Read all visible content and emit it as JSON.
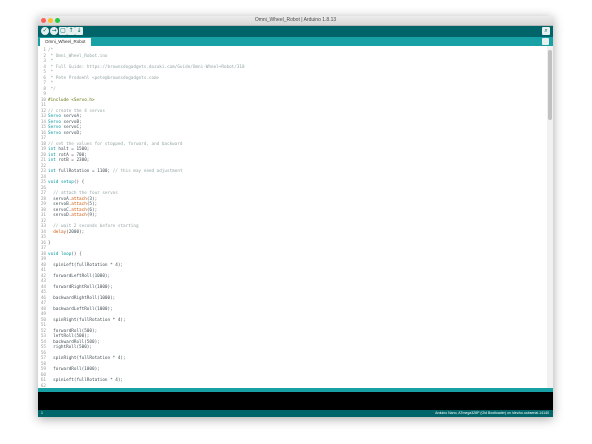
{
  "window": {
    "title": "Omni_Wheel_Robot | Arduino 1.8.13"
  },
  "toolbar": {
    "buttons": [
      {
        "name": "verify-button",
        "glyph": "✓"
      },
      {
        "name": "upload-button",
        "glyph": "→"
      },
      {
        "name": "new-button",
        "glyph": "▢"
      },
      {
        "name": "open-button",
        "glyph": "↑"
      },
      {
        "name": "save-button",
        "glyph": "↓"
      }
    ],
    "serial_glyph": "⌕"
  },
  "tabs": [
    {
      "label": "Omni_Wheel_Robot"
    }
  ],
  "editor": {
    "lines": [
      {
        "n": "1",
        "seg": [
          [
            "cm",
            "/*"
          ]
        ]
      },
      {
        "n": "2",
        "seg": [
          [
            "cm",
            " * Omni_Wheel_Robot.ino"
          ]
        ]
      },
      {
        "n": "3",
        "seg": [
          [
            "cm",
            " *"
          ]
        ]
      },
      {
        "n": "4",
        "seg": [
          [
            "cm",
            " * Full Guide: https://brownsdogadgets.dozuki.com/Guide/Omni-Wheel+Robot/318"
          ]
        ]
      },
      {
        "n": "5",
        "seg": [
          [
            "cm",
            " *"
          ]
        ]
      },
      {
        "n": "6",
        "seg": [
          [
            "cm",
            " * Pete Prodoehl <pete@brownsdogadgets.com>"
          ]
        ]
      },
      {
        "n": "7",
        "seg": [
          [
            "cm",
            " *"
          ]
        ]
      },
      {
        "n": "8",
        "seg": [
          [
            "cm",
            " */"
          ]
        ]
      },
      {
        "n": "9",
        "seg": []
      },
      {
        "n": "10",
        "seg": [
          [
            "pp",
            "#include <Servo.h>"
          ]
        ]
      },
      {
        "n": "11",
        "seg": []
      },
      {
        "n": "12",
        "seg": [
          [
            "cm",
            "// create the 4 servos"
          ]
        ]
      },
      {
        "n": "13",
        "seg": [
          [
            "ty",
            "Servo"
          ],
          [
            "",
            " servoA;"
          ]
        ]
      },
      {
        "n": "14",
        "seg": [
          [
            "ty",
            "Servo"
          ],
          [
            "",
            " servoB;"
          ]
        ]
      },
      {
        "n": "15",
        "seg": [
          [
            "ty",
            "Servo"
          ],
          [
            "",
            " servoC;"
          ]
        ]
      },
      {
        "n": "16",
        "seg": [
          [
            "ty",
            "Servo"
          ],
          [
            "",
            " servoD;"
          ]
        ]
      },
      {
        "n": "17",
        "seg": []
      },
      {
        "n": "18",
        "seg": [
          [
            "cm",
            "// set the values for stopped, forward, and backward"
          ]
        ]
      },
      {
        "n": "19",
        "seg": [
          [
            "ty",
            "int"
          ],
          [
            "",
            " halt = 1500;"
          ]
        ]
      },
      {
        "n": "20",
        "seg": [
          [
            "ty",
            "int"
          ],
          [
            "",
            " rotA = 700;"
          ]
        ]
      },
      {
        "n": "21",
        "seg": [
          [
            "ty",
            "int"
          ],
          [
            "",
            " rotB = 2300;"
          ]
        ]
      },
      {
        "n": "22",
        "seg": []
      },
      {
        "n": "23",
        "seg": [
          [
            "ty",
            "int"
          ],
          [
            "",
            " fullRotation = 1100; "
          ],
          [
            "cm",
            "// this may need adjustment"
          ]
        ]
      },
      {
        "n": "24",
        "seg": []
      },
      {
        "n": "25",
        "seg": [
          [
            "ty",
            "void"
          ],
          [
            "",
            " "
          ],
          [
            "kw",
            "setup"
          ],
          [
            "",
            "() {"
          ]
        ]
      },
      {
        "n": "26",
        "seg": []
      },
      {
        "n": "27",
        "seg": [
          [
            "",
            "  "
          ],
          [
            "cm",
            "// attach the four servos"
          ]
        ]
      },
      {
        "n": "28",
        "seg": [
          [
            "",
            "  servoA."
          ],
          [
            "fn",
            "attach"
          ],
          [
            "",
            "(3);"
          ]
        ]
      },
      {
        "n": "29",
        "seg": [
          [
            "",
            "  servoB."
          ],
          [
            "fn",
            "attach"
          ],
          [
            "",
            "(5);"
          ]
        ]
      },
      {
        "n": "30",
        "seg": [
          [
            "",
            "  servoC."
          ],
          [
            "fn",
            "attach"
          ],
          [
            "",
            "(6);"
          ]
        ]
      },
      {
        "n": "31",
        "seg": [
          [
            "",
            "  servoD."
          ],
          [
            "fn",
            "attach"
          ],
          [
            "",
            "(9);"
          ]
        ]
      },
      {
        "n": "32",
        "seg": []
      },
      {
        "n": "33",
        "seg": [
          [
            "",
            "  "
          ],
          [
            "cm",
            "// wait 2 seconds before starting"
          ]
        ]
      },
      {
        "n": "34",
        "seg": [
          [
            "",
            "  "
          ],
          [
            "fn",
            "delay"
          ],
          [
            "",
            "(2000);"
          ]
        ]
      },
      {
        "n": "35",
        "seg": []
      },
      {
        "n": "36",
        "seg": [
          [
            "",
            "}"
          ]
        ]
      },
      {
        "n": "37",
        "seg": []
      },
      {
        "n": "38",
        "seg": [
          [
            "ty",
            "void"
          ],
          [
            "",
            " "
          ],
          [
            "kw",
            "loop"
          ],
          [
            "",
            "() {"
          ]
        ]
      },
      {
        "n": "39",
        "seg": []
      },
      {
        "n": "40",
        "seg": [
          [
            "",
            "  spinLeft(fullRotation * 4);"
          ]
        ]
      },
      {
        "n": "41",
        "seg": []
      },
      {
        "n": "42",
        "seg": [
          [
            "",
            "  forwardLeftRoll(1000);"
          ]
        ]
      },
      {
        "n": "43",
        "seg": []
      },
      {
        "n": "44",
        "seg": [
          [
            "",
            "  forwardRightRoll(1000);"
          ]
        ]
      },
      {
        "n": "45",
        "seg": []
      },
      {
        "n": "46",
        "seg": [
          [
            "",
            "  backwardRightRoll(1000);"
          ]
        ]
      },
      {
        "n": "47",
        "seg": []
      },
      {
        "n": "48",
        "seg": [
          [
            "",
            "  backwardLeftRoll(1000);"
          ]
        ]
      },
      {
        "n": "49",
        "seg": []
      },
      {
        "n": "50",
        "seg": [
          [
            "",
            "  spinRight(fullRotation * 4);"
          ]
        ]
      },
      {
        "n": "51",
        "seg": []
      },
      {
        "n": "52",
        "seg": [
          [
            "",
            "  forwardRoll(500);"
          ]
        ]
      },
      {
        "n": "53",
        "seg": [
          [
            "",
            "  leftRoll(500);"
          ]
        ]
      },
      {
        "n": "54",
        "seg": [
          [
            "",
            "  backwardRoll(500);"
          ]
        ]
      },
      {
        "n": "55",
        "seg": [
          [
            "",
            "  rightRoll(500);"
          ]
        ]
      },
      {
        "n": "56",
        "seg": []
      },
      {
        "n": "57",
        "seg": [
          [
            "",
            "  spinRight(fullRotation * 4);"
          ]
        ]
      },
      {
        "n": "58",
        "seg": []
      },
      {
        "n": "59",
        "seg": [
          [
            "",
            "  forwardRoll(1000);"
          ]
        ]
      },
      {
        "n": "60",
        "seg": []
      },
      {
        "n": "61",
        "seg": [
          [
            "",
            "  spinLeft(fullRotation * 4);"
          ]
        ]
      },
      {
        "n": "62",
        "seg": []
      }
    ]
  },
  "status": {
    "line_number": "1",
    "board": "Arduino Nano, ATmega328P (Old Bootloader) on /dev/cu.usbserial-14140"
  },
  "colors": {
    "toolbar": "#006468",
    "tabbar": "#17a1a5",
    "console": "#000000"
  }
}
